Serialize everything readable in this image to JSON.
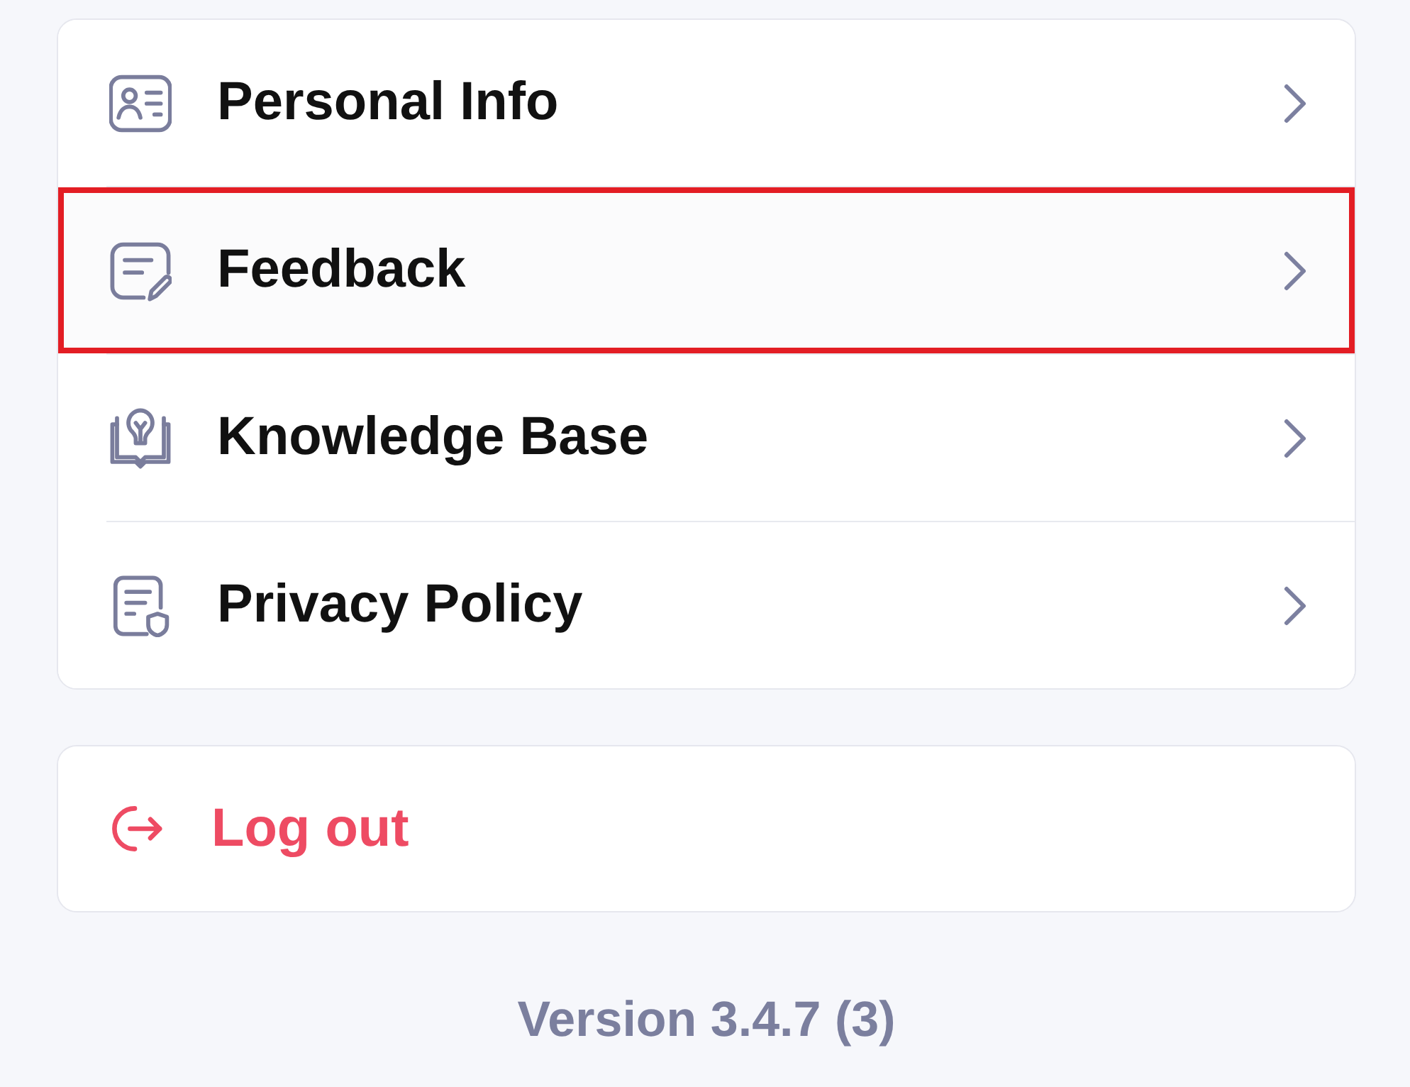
{
  "menu_items": [
    {
      "label": "Personal Info",
      "highlighted": false
    },
    {
      "label": "Feedback",
      "highlighted": true
    },
    {
      "label": "Knowledge Base",
      "highlighted": false
    },
    {
      "label": "Privacy Policy",
      "highlighted": false
    }
  ],
  "logout": {
    "label": "Log out"
  },
  "version": "Version 3.4.7 (3)"
}
